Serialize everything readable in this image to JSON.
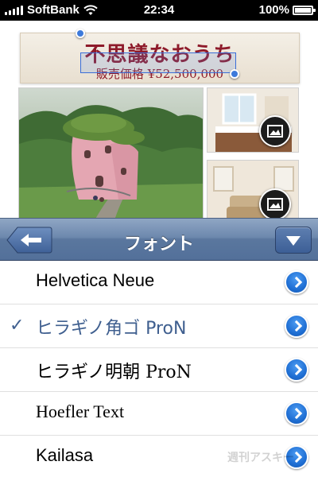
{
  "status_bar": {
    "carrier": "SoftBank",
    "time": "22:34",
    "battery_percent": "100%",
    "battery_level": 1.0
  },
  "document": {
    "title": "不思議なおうち",
    "subtitle": "販売価格 ¥52,500,000"
  },
  "popover": {
    "title": "フォント",
    "back_icon": "left-arrow-icon",
    "menu_icon": "triangle-down-icon"
  },
  "font_list": {
    "items": [
      {
        "label": "Helvetica Neue",
        "selected": false
      },
      {
        "label": "ヒラギノ角ゴ ProN",
        "selected": true
      },
      {
        "label": "ヒラギノ明朝 ProN",
        "selected": false
      },
      {
        "label": "Hoefler Text",
        "selected": false
      },
      {
        "label": "Kailasa",
        "selected": false
      }
    ],
    "checkmark": "✓"
  },
  "watermark": "週刊アスキー",
  "colors": {
    "title_red": "#8e1a2a",
    "header_blue": "#6d88ad",
    "selected_text": "#3f5f8f",
    "disclosure_blue": "#1f6fd4"
  }
}
